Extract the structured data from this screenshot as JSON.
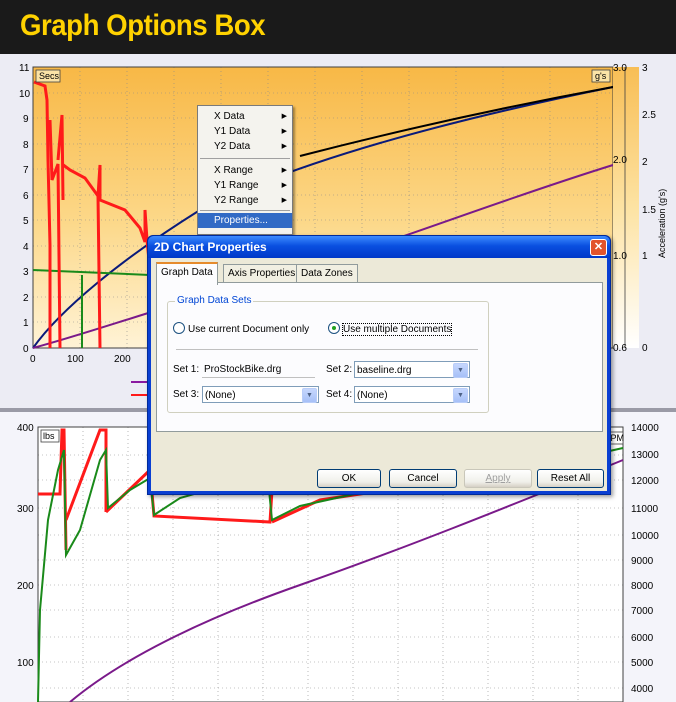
{
  "banner": {
    "title": "Graph Options Box"
  },
  "top_chart": {
    "left_axis_unit": "Secs",
    "right_axis_unit": "g's",
    "right_axis_title": "Acceleration (g's)",
    "y_ticks": [
      "11",
      "10",
      "9",
      "8",
      "7",
      "6",
      "5",
      "4",
      "3",
      "2",
      "1",
      "0"
    ],
    "x_ticks": [
      "0",
      "100",
      "200"
    ],
    "right_inner_ticks": [
      "3.0",
      "2.0",
      "1.0",
      "0.6"
    ],
    "right_outer_ticks": [
      "3",
      "2.5",
      "2",
      "1.5",
      "1",
      "0"
    ]
  },
  "bottom_chart": {
    "left_axis_unit": "lbs",
    "right_axis_unit": "RPM",
    "y_ticks": [
      "400",
      "300",
      "200",
      "100"
    ],
    "right_ticks": [
      "14000",
      "13000",
      "12000",
      "11000",
      "10000",
      "9000",
      "8000",
      "7000",
      "6000",
      "5000",
      "4000"
    ]
  },
  "context_menu": {
    "items": [
      "X  Data",
      "Y1  Data",
      "Y2  Data",
      "X  Range",
      "Y1  Range",
      "Y2  Range",
      "Properties..."
    ]
  },
  "dialog": {
    "title": "2D Chart Properties",
    "close_glyph": "✕",
    "tabs": [
      "Graph Data",
      "Axis Properties",
      "Data Zones"
    ],
    "group_title": "Graph Data Sets",
    "radio_current": "Use current Document only",
    "radio_multiple": "Use multiple Documents",
    "set1_label": "Set 1:",
    "set1_value": "ProStockBike.drg",
    "set2_label": "Set 2:",
    "set2_value": "baseline.drg",
    "set3_label": "Set 3:",
    "set3_value": "(None)",
    "set4_label": "Set 4:",
    "set4_value": "(None)",
    "buttons": {
      "ok": "OK",
      "cancel": "Cancel",
      "apply": "Apply",
      "reset": "Reset All"
    }
  },
  "colors": {
    "banner_bg": "#1a1a1a",
    "banner_text": "#ffd200",
    "dialog_title": "#0a4fe0"
  }
}
